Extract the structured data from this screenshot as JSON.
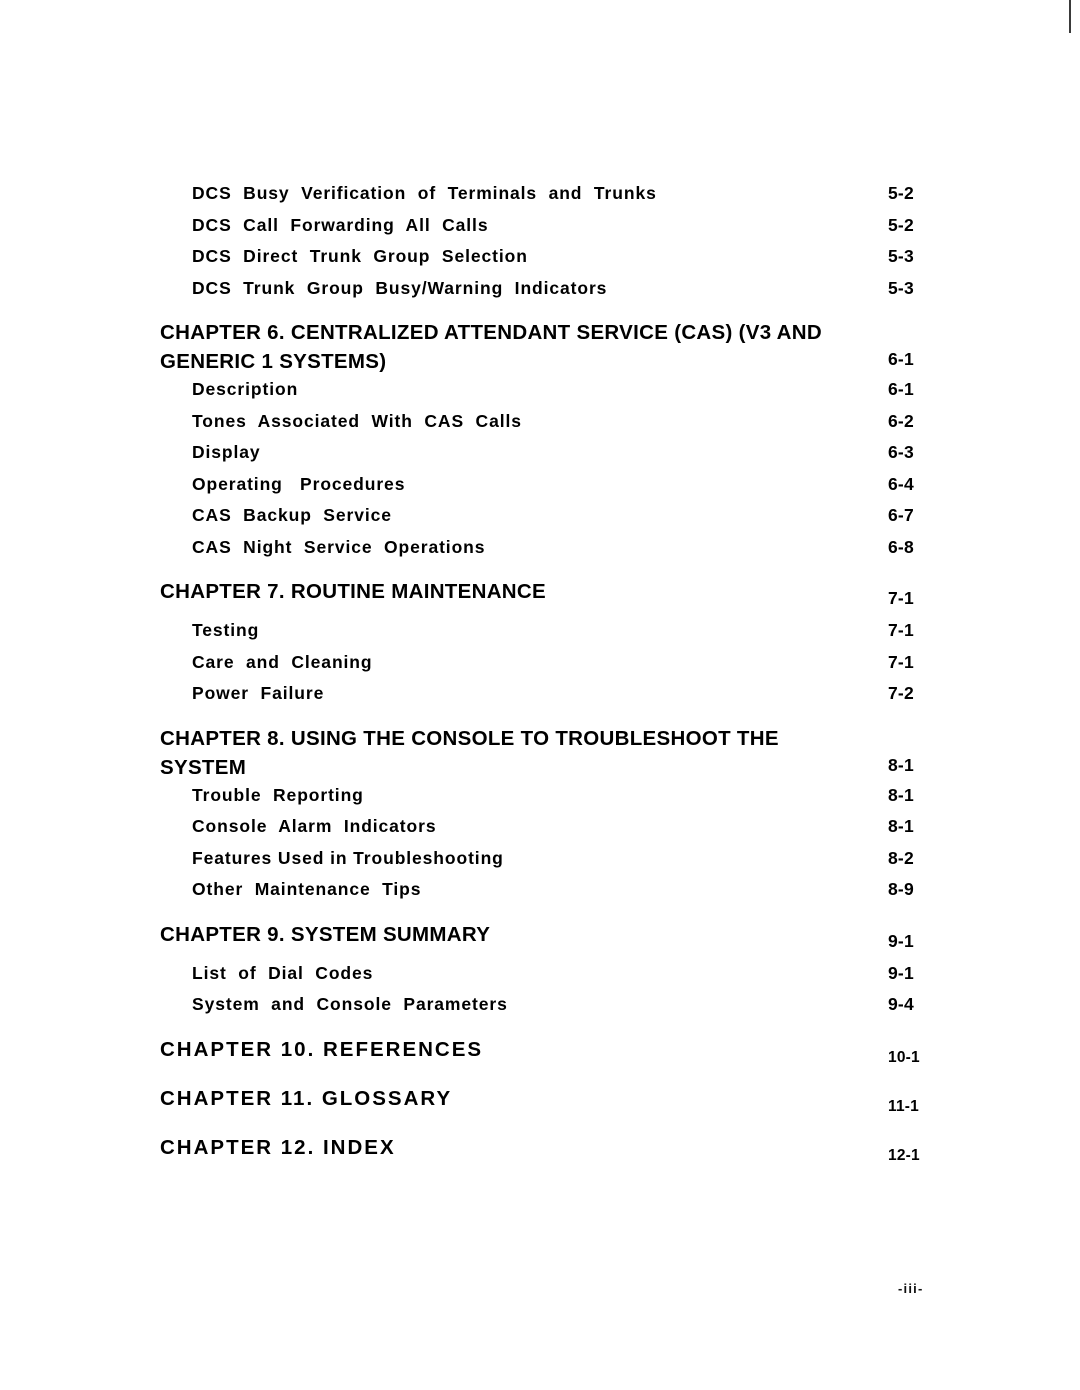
{
  "document": {
    "type": "table-of-contents",
    "folio": "-iii-"
  },
  "toc": {
    "rows": [
      {
        "kind": "entry",
        "label": "DCS  Busy  Verification  of  Terminals  and  Trunks",
        "page": "5-2"
      },
      {
        "kind": "entry",
        "label": "DCS  Call  Forwarding  All  Calls",
        "page": "5-2"
      },
      {
        "kind": "entry",
        "label": "DCS  Direct  Trunk  Group  Selection",
        "page": "5-3"
      },
      {
        "kind": "entry",
        "label": "DCS  Trunk  Group  Busy/Warning  Indicators",
        "page": "5-3"
      },
      {
        "kind": "chapter",
        "label": "CHAPTER 6. CENTRALIZED ATTENDANT SERVICE (CAS) (V3 AND\nGENERIC  1  SYSTEMS)",
        "page": "6-1",
        "lines": 2
      },
      {
        "kind": "entry",
        "label": "Description",
        "page": "6-1"
      },
      {
        "kind": "entry",
        "label": "Tones  Associated  With  CAS  Calls",
        "page": "6-2"
      },
      {
        "kind": "entry",
        "label": "Display",
        "page": "6-3"
      },
      {
        "kind": "entry",
        "label": "Operating   Procedures",
        "page": "6-4"
      },
      {
        "kind": "entry",
        "label": "CAS  Backup  Service",
        "page": "6-7"
      },
      {
        "kind": "entry",
        "label": "CAS  Night  Service  Operations",
        "page": "6-8"
      },
      {
        "kind": "chapter",
        "label": "CHAPTER 7. ROUTINE  MAINTENANCE",
        "page": "7-1",
        "lines": 1
      },
      {
        "kind": "entry",
        "label": "Testing",
        "page": "7-1"
      },
      {
        "kind": "entry",
        "label": "Care  and  Cleaning",
        "page": "7-1"
      },
      {
        "kind": "entry",
        "label": "Power  Failure",
        "page": "7-2"
      },
      {
        "kind": "chapter",
        "label": "CHAPTER 8. USING THE CONSOLE TO TROUBLESHOOT THE\nSYSTEM",
        "page": "8-1",
        "lines": 2
      },
      {
        "kind": "entry",
        "label": "Trouble  Reporting",
        "page": "8-1"
      },
      {
        "kind": "entry",
        "label": "Console  Alarm  Indicators",
        "page": "8-1"
      },
      {
        "kind": "entry",
        "label": "Features Used in Troubleshooting",
        "page": "8-2"
      },
      {
        "kind": "entry",
        "label": "Other  Maintenance  Tips",
        "page": "8-9"
      },
      {
        "kind": "chapter",
        "label": "CHAPTER 9. SYSTEM SUMMARY",
        "page": "9-1",
        "lines": 1
      },
      {
        "kind": "entry",
        "label": "List  of  Dial  Codes",
        "page": "9-1"
      },
      {
        "kind": "entry",
        "label": "System  and  Console  Parameters",
        "page": "9-4"
      },
      {
        "kind": "chapter",
        "label": "CHAPTER  10.  REFERENCES",
        "page": "10-1",
        "lines": 1,
        "wide": true,
        "smallPage": true
      },
      {
        "kind": "chapter",
        "label": "CHAPTER  11.  GLOSSARY",
        "page": "11-1",
        "lines": 1,
        "wide": true,
        "smallPage": true
      },
      {
        "kind": "chapter",
        "label": "CHAPTER  12.  INDEX",
        "page": "12-1",
        "lines": 1,
        "wide": true,
        "smallPage": true
      }
    ]
  }
}
